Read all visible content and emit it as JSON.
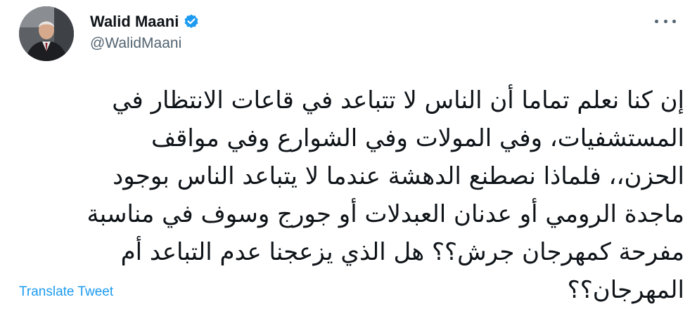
{
  "author": {
    "display_name": "Walid Maani",
    "handle": "@WalidMaani",
    "verified": true,
    "avatar_icon": "profile-photo"
  },
  "menu": {
    "icon": "more-options-icon"
  },
  "tweet": {
    "lines": [
      "إن كنا نعلم تماما أن الناس لا تتباعد في قاعات الانتظار في",
      "المستشفيات، وفي المولات وفي الشوارع وفي مواقف",
      "الحزن،، فلماذا نصطنع الدهشة عندما لا يتباعد الناس بوجود",
      "ماجدة الرومي أو عدنان العبدلات أو جورج وسوف في مناسبة",
      "مفرحة كمهرجان جرش؟؟ هل الذي يزعجنا عدم التباعد أم",
      "المهرجان؟؟"
    ]
  },
  "actions": {
    "translate_label": "Translate Tweet"
  },
  "colors": {
    "accent": "#1d9bf0",
    "text": "#0f1419",
    "secondary": "#536471"
  }
}
